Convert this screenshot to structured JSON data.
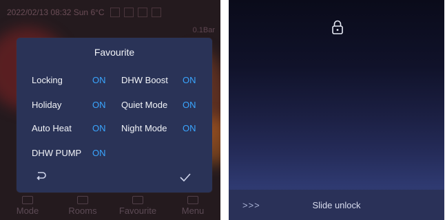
{
  "left": {
    "status": {
      "datetime": "2022/02/13 08:32 Sun 6°C",
      "extra": "0.1Bar"
    },
    "dialog": {
      "title": "Favourite",
      "options": [
        {
          "label": "Locking",
          "value": "ON"
        },
        {
          "label": "DHW Boost",
          "value": "ON"
        },
        {
          "label": "Holiday",
          "value": "ON"
        },
        {
          "label": "Quiet Mode",
          "value": "ON"
        },
        {
          "label": "Auto Heat",
          "value": "ON"
        },
        {
          "label": "Night Mode",
          "value": "ON"
        },
        {
          "label": "DHW PUMP",
          "value": "ON"
        }
      ],
      "back_icon": "return-arrow-icon",
      "confirm_icon": "checkmark-icon"
    },
    "nav": [
      {
        "label": "Mode",
        "icon": "mode-icon"
      },
      {
        "label": "Rooms",
        "icon": "rooms-icon"
      },
      {
        "label": "Favourite",
        "icon": "favourite-icon"
      },
      {
        "label": "Menu",
        "icon": "menu-icon"
      }
    ]
  },
  "right": {
    "lock_icon": "lock-icon",
    "slider": {
      "chevrons": ">>>",
      "label": "Slide unlock"
    }
  },
  "colors": {
    "accent": "#3aa6ff",
    "dialog": "#2a3357"
  }
}
